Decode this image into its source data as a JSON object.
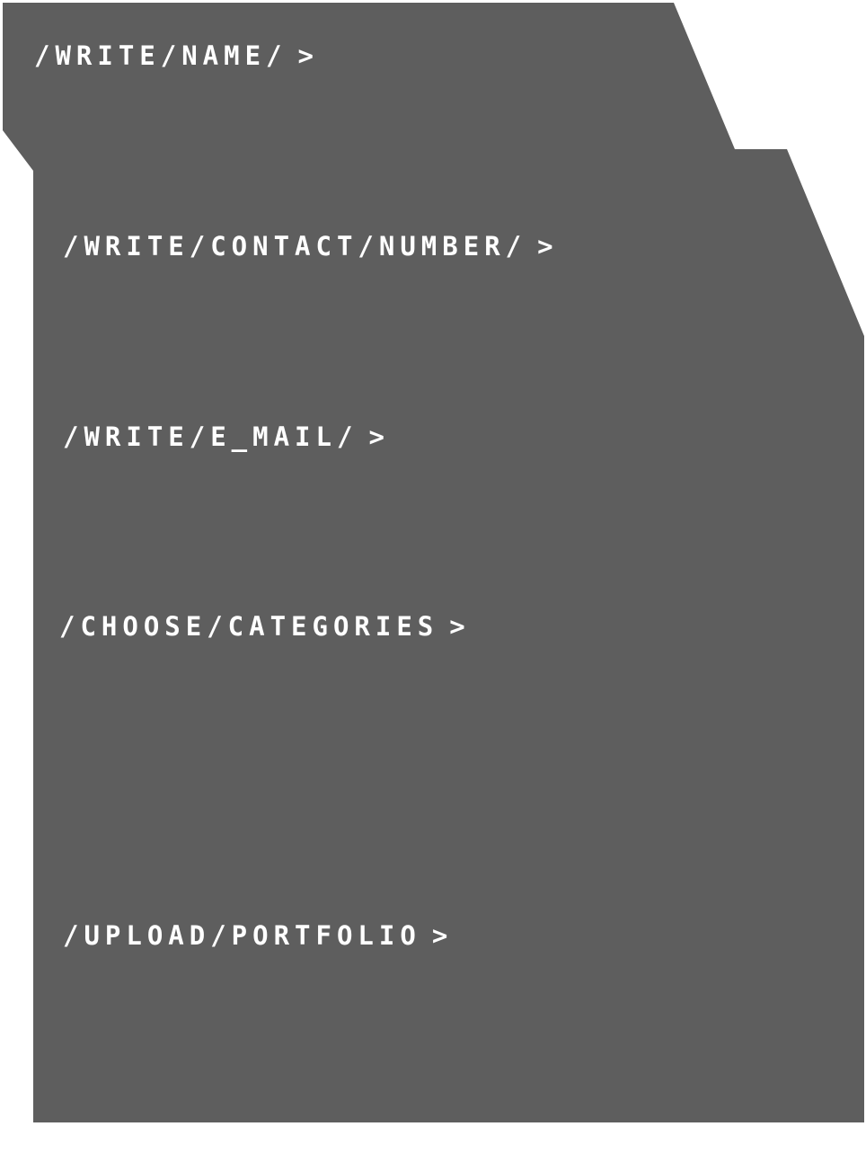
{
  "colors": {
    "panel": "#5e5e5e",
    "text": "#ffffff",
    "background": "#ffffff"
  },
  "fields": {
    "name": {
      "label": "/WRITE/NAME/",
      "arrow": ">"
    },
    "contact": {
      "label": "/WRITE/CONTACT/NUMBER/",
      "arrow": ">"
    },
    "email": {
      "label": "/WRITE/E_MAIL/",
      "arrow": ">"
    },
    "categories": {
      "label": "/CHOOSE/CATEGORIES",
      "arrow": ">"
    },
    "portfolio": {
      "label": "/UPLOAD/PORTFOLIO",
      "arrow": ">"
    }
  }
}
